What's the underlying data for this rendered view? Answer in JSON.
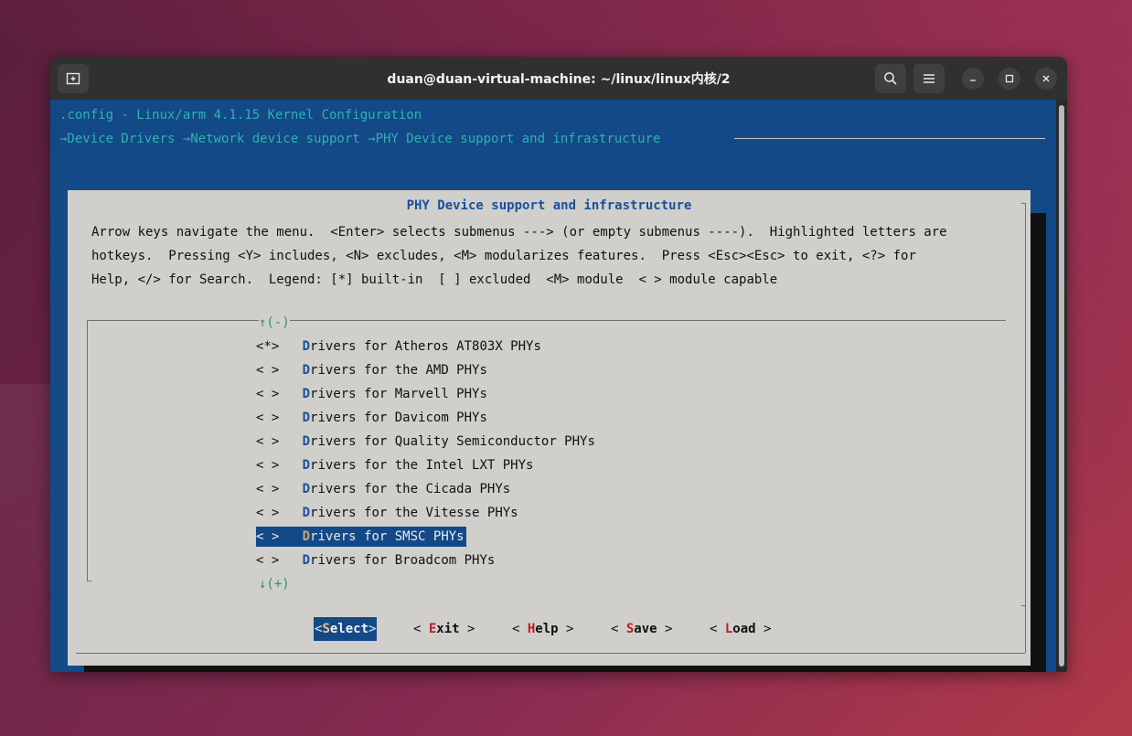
{
  "window": {
    "title": "duan@duan-virtual-machine: ~/linux/linux内核/2"
  },
  "terminal": {
    "header": ".config - Linux/arm 4.1.15 Kernel Configuration",
    "breadcrumb": "→Device Drivers →Network device support →PHY Device support and infrastructure"
  },
  "dialog": {
    "title": "PHY Device support and infrastructure",
    "help_lines": [
      "Arrow keys navigate the menu.  <Enter> selects submenus ---> (or empty submenus ----).  Highlighted letters are",
      "hotkeys.  Pressing <Y> includes, <N> excludes, <M> modularizes features.  Press <Esc><Esc> to exit, <?> for",
      "Help, </> for Search.  Legend: [*] built-in  [ ] excluded  <M> module  < > module capable"
    ],
    "scroll_up": "↑(-)",
    "scroll_down": "↓(+)",
    "items": [
      {
        "state": "<*>",
        "hotkey": "D",
        "rest": "rivers for Atheros AT803X PHYs",
        "selected": false
      },
      {
        "state": "< >",
        "hotkey": "D",
        "rest": "rivers for the AMD PHYs",
        "selected": false
      },
      {
        "state": "< >",
        "hotkey": "D",
        "rest": "rivers for Marvell PHYs",
        "selected": false
      },
      {
        "state": "< >",
        "hotkey": "D",
        "rest": "rivers for Davicom PHYs",
        "selected": false
      },
      {
        "state": "< >",
        "hotkey": "D",
        "rest": "rivers for Quality Semiconductor PHYs",
        "selected": false
      },
      {
        "state": "< >",
        "hotkey": "D",
        "rest": "rivers for the Intel LXT PHYs",
        "selected": false
      },
      {
        "state": "< >",
        "hotkey": "D",
        "rest": "rivers for the Cicada PHYs",
        "selected": false
      },
      {
        "state": "< >",
        "hotkey": "D",
        "rest": "rivers for the Vitesse PHYs",
        "selected": false
      },
      {
        "state": "< >",
        "hotkey": "D",
        "rest": "rivers for SMSC PHYs",
        "selected": true
      },
      {
        "state": "< >",
        "hotkey": "D",
        "rest": "rivers for Broadcom PHYs",
        "selected": false
      }
    ],
    "buttons": [
      {
        "pre": "<",
        "hotkey": "S",
        "rest": "elect",
        "post": ">",
        "selected": true
      },
      {
        "pre": "< ",
        "hotkey": "E",
        "rest": "xit",
        "post": " >",
        "selected": false
      },
      {
        "pre": "< ",
        "hotkey": "H",
        "rest": "elp",
        "post": " >",
        "selected": false
      },
      {
        "pre": "< ",
        "hotkey": "S",
        "rest": "ave",
        "post": " >",
        "selected": false
      },
      {
        "pre": "< ",
        "hotkey": "L",
        "rest": "oad",
        "post": " >",
        "selected": false
      }
    ]
  },
  "colors": {
    "terminal_bg": "#134987",
    "dialog_bg": "#d0cfcc",
    "header_text": "#31b1b0",
    "hotkey_blue": "#1a4f9c",
    "button_hotkey": "#b8202a"
  }
}
